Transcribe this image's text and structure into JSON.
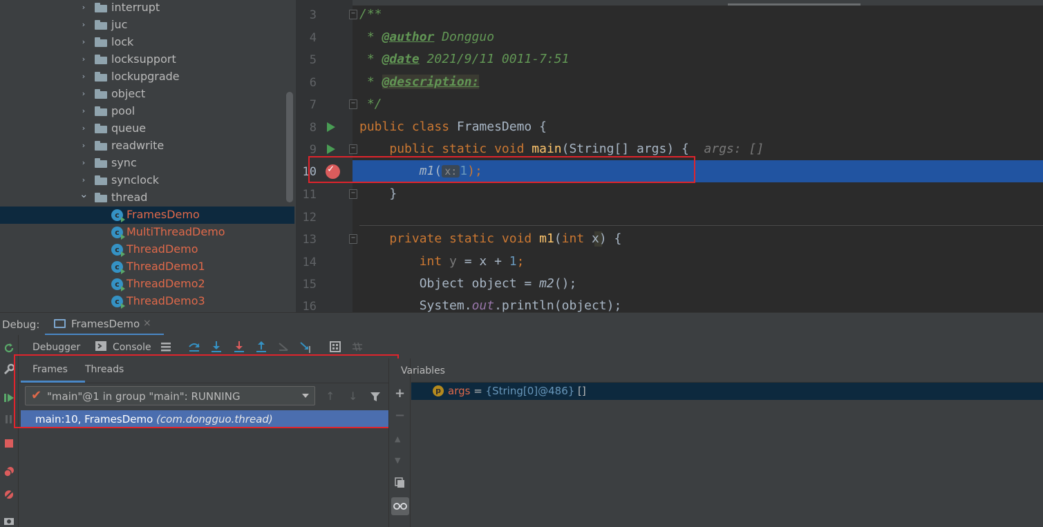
{
  "project_tree": {
    "folders": [
      "interrupt",
      "juc",
      "lock",
      "locksupport",
      "lockupgrade",
      "object",
      "pool",
      "queue",
      "readwrite",
      "sync",
      "synclock"
    ],
    "open_folder": "thread",
    "classes": [
      "FramesDemo",
      "MultiThreadDemo",
      "ThreadDemo",
      "ThreadDemo1",
      "ThreadDemo2",
      "ThreadDemo3"
    ],
    "selected_class": "FramesDemo",
    "class_icon_letter": "c"
  },
  "editor": {
    "line_numbers": [
      "3",
      "4",
      "5",
      "6",
      "7",
      "8",
      "9",
      "10",
      "11",
      "12",
      "13",
      "14",
      "15",
      "16"
    ],
    "current_line": "10",
    "code": {
      "l3": "/**",
      "l4_star": " * ",
      "l4_tag": "@author",
      "l4_val": " Dongguo",
      "l5_star": " * ",
      "l5_tag": "@date",
      "l5_val": " 2021/9/11 0011-7:51",
      "l6_star": " * ",
      "l6_tag": "@description:",
      "l7": " */",
      "l8_kw": "public class ",
      "l8_name": "FramesDemo {",
      "l9_indent": "    ",
      "l9_kw": "public static void ",
      "l9_fn": "main",
      "l9_rest": "(String[] args) {",
      "l9_hint": "  args: []",
      "l10_indent": "        ",
      "l10_fn": "m1",
      "l10_open": "(",
      "l10_hint": "x:",
      "l10_num": "1",
      "l10_close": ");",
      "l11": "    }",
      "l13_indent": "    ",
      "l13_kw": "private static void ",
      "l13_fn": "m1",
      "l13_open": "(",
      "l13_kw2": "int",
      "l13_rest": " x) {",
      "l14_indent": "        ",
      "l14_kw": "int",
      "l14_var": " y",
      "l14_eq": " = x + ",
      "l14_num": "1",
      "l14_end": ";",
      "l15_indent": "        ",
      "l15_a": "Object object = ",
      "l15_fn": "m2",
      "l15_b": "();",
      "l16_indent": "        ",
      "l16_a": "System.",
      "l16_field": "out",
      "l16_b": ".println(object);"
    }
  },
  "debug": {
    "label": "Debug:",
    "tab_name": "FramesDemo",
    "close_glyph": "×",
    "toolbar": {
      "debugger": "Debugger",
      "console": "Console"
    },
    "frames_tab": "Frames",
    "threads_tab": "Threads",
    "thread_selector": "\"main\"@1 in group \"main\": RUNNING",
    "frame_location": "main:10, FramesDemo",
    "frame_package": "(com.dongguo.thread)",
    "variables_title": "Variables",
    "variable": {
      "badge": "p",
      "name": "args",
      "eq": " = ",
      "value": "{String[0]@486}",
      "extra": " []"
    }
  },
  "colors": {
    "accent": "#4a88c7",
    "highlight_box": "#e0242c",
    "current_line": "#2154a1",
    "selected_frame": "#4b6eaf"
  },
  "icons": [
    "folder-icon",
    "class-icon",
    "run-gutter-icon",
    "breakpoint-icon",
    "fold-icon",
    "rerun-icon",
    "resume-icon",
    "pause-icon",
    "stop-icon",
    "step-over-icon",
    "step-into-icon",
    "force-step-into-icon",
    "step-out-icon",
    "evaluate-icon",
    "filter-icon",
    "add-watch-icon",
    "glasses-icon"
  ]
}
